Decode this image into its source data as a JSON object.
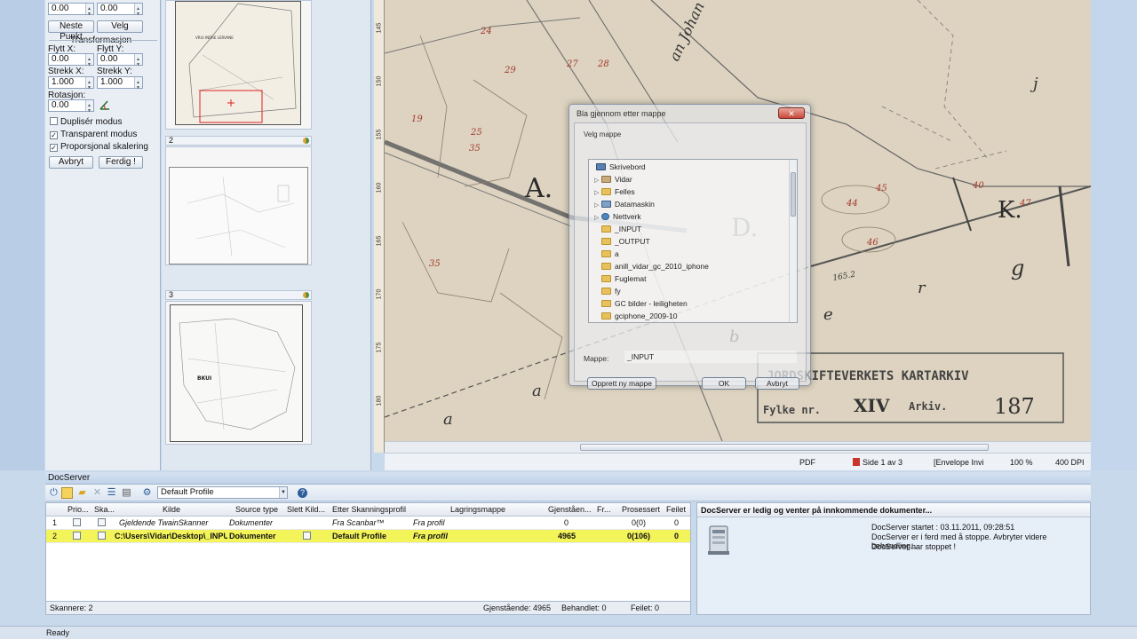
{
  "transform": {
    "x_value": "0.00",
    "y_value": "0.00",
    "next_point_label": "Neste Punkt",
    "select_label": "Velg",
    "group_label": "Transformasjon",
    "move_x_label": "Flytt X:",
    "move_y_label": "Flytt Y:",
    "move_x_value": "0.00",
    "move_y_value": "0.00",
    "stretch_x_label": "Strekk X:",
    "stretch_y_label": "Strekk Y:",
    "stretch_x_value": "1.000",
    "stretch_y_value": "1.000",
    "rotation_label": "Rotasjon:",
    "rotation_value": "0.00",
    "duplicate_label": "Duplisér modus",
    "duplicate_checked": false,
    "transparent_label": "Transparent modus",
    "transparent_checked": true,
    "proportional_label": "Proporsjonal skalering",
    "proportional_checked": true,
    "cancel_label": "Avbryt",
    "done_label": "Ferdig !"
  },
  "thumbnails": [
    {
      "number": "",
      "title": "VRIU INDRE LERVANE"
    },
    {
      "number": "2",
      "title": ""
    },
    {
      "number": "3",
      "title": "BKUI"
    }
  ],
  "map": {
    "ruler_ticks": [
      "145",
      "150",
      "155",
      "160",
      "165",
      "170",
      "175",
      "180"
    ],
    "labels": [
      "A.",
      "D.",
      "K.",
      "g",
      "r",
      "e",
      "a",
      "b",
      "a",
      "j",
      "an Johan"
    ],
    "stamp_line1": "JORDSKIFTEVERKETS KARTARKIV",
    "stamp_line2_a": "Fylke nr.",
    "stamp_line2_b": "XIV",
    "stamp_line2_c": "Arkiv.",
    "stamp_number": "187",
    "parcel_numbers": [
      "24",
      "27",
      "28",
      "29",
      "35",
      "40",
      "44",
      "45",
      "46",
      "47",
      "19",
      "25",
      "35"
    ],
    "measure": "165.2"
  },
  "doc_status": {
    "format": "PDF",
    "page": "Side 1 av 3",
    "envelope": "[Envelope Invi",
    "zoom": "100 %",
    "dpi": "400 DPI"
  },
  "dialog": {
    "title": "Bla gjennom etter mappe",
    "close": "✕",
    "instruction": "Velg mappe",
    "tree": [
      {
        "label": "Skrivebord",
        "icon": "desktop-icon",
        "kind": "desk",
        "indent": 0,
        "expander": ""
      },
      {
        "label": "Vidar",
        "icon": "user-folder-icon",
        "kind": "user",
        "indent": 1,
        "expander": "▷"
      },
      {
        "label": "Felles",
        "icon": "folder-icon",
        "kind": "folder",
        "indent": 1,
        "expander": "▷"
      },
      {
        "label": "Datamaskin",
        "icon": "computer-icon",
        "kind": "comp",
        "indent": 1,
        "expander": "▷"
      },
      {
        "label": "Nettverk",
        "icon": "network-icon",
        "kind": "net",
        "indent": 1,
        "expander": "▷"
      },
      {
        "label": "_INPUT",
        "icon": "folder-icon",
        "kind": "folder",
        "indent": 1,
        "expander": ""
      },
      {
        "label": "_OUTPUT",
        "icon": "folder-icon",
        "kind": "folder",
        "indent": 1,
        "expander": ""
      },
      {
        "label": "a",
        "icon": "folder-icon",
        "kind": "folder",
        "indent": 1,
        "expander": ""
      },
      {
        "label": "anill_vidar_gc_2010_iphone",
        "icon": "folder-icon",
        "kind": "folder",
        "indent": 1,
        "expander": ""
      },
      {
        "label": "Fuglemat",
        "icon": "folder-icon",
        "kind": "folder",
        "indent": 1,
        "expander": ""
      },
      {
        "label": "fy",
        "icon": "folder-icon",
        "kind": "folder",
        "indent": 1,
        "expander": ""
      },
      {
        "label": "GC bilder - leiligheten",
        "icon": "folder-icon",
        "kind": "folder",
        "indent": 1,
        "expander": ""
      },
      {
        "label": "gciphone_2009-10",
        "icon": "folder-icon",
        "kind": "folder",
        "indent": 1,
        "expander": ""
      }
    ],
    "folder_label": "Mappe:",
    "folder_value": "_INPUT",
    "new_folder_label": "Opprett ny mappe",
    "ok_label": "OK",
    "cancel_label": "Avbryt"
  },
  "docserver": {
    "title": "DocServer",
    "profile": "Default Profile",
    "columns": [
      "Prio...",
      "Ska...",
      "Kilde",
      "Source type",
      "Slett Kild...",
      "Etter Skanningsprofil",
      "Lagringsmappe",
      "Gjenståen...",
      "Fr...",
      "Prosessert",
      "Feilet"
    ],
    "rows": [
      {
        "num": "1",
        "prio": false,
        "scan": false,
        "source": "Gjeldende TwainSkanner",
        "type": "Dokumenter",
        "delete": "",
        "profile": "Fra Scanbar™",
        "folder": "Fra profil",
        "remaining": "0",
        "fr": "",
        "processed": "0(0)",
        "failed": "0",
        "selected": false
      },
      {
        "num": "2",
        "prio": false,
        "scan": false,
        "source": "C:\\Users\\Vidar\\Desktop\\_INPUT",
        "type": "Dokumenter",
        "delete": "box",
        "profile": "Default Profile",
        "folder": "Fra profil",
        "remaining": "4965",
        "fr": "",
        "processed": "0(106)",
        "failed": "0",
        "selected": true
      }
    ],
    "scanners": "Skannere: 2",
    "remaining_total": "Gjenstående: 4965",
    "handled": "Behandlet: 0",
    "failed_total": "Feilet: 0",
    "log_title": "DocServer er ledig og venter på innkommende dokumenter...",
    "log_lines": [
      "DocServer startet : 03.11.2011, 09:28:51",
      "DocServer er i ferd med å stoppe. Avbryter videre behandling...",
      "DocServer har stoppet !"
    ]
  },
  "statusbar": {
    "text": "Ready"
  }
}
